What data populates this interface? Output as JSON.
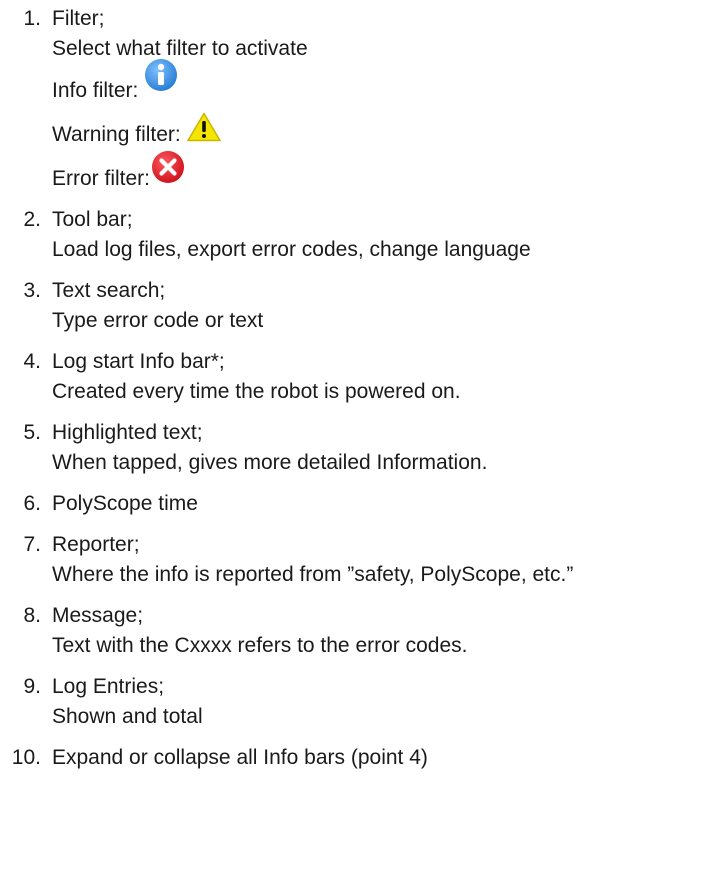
{
  "items": [
    {
      "number": "1.",
      "title": "Filter;",
      "description": "Select what filter to activate",
      "filters": [
        {
          "label": "Info filter:",
          "icon": "info-icon",
          "color": "#3b8fe0"
        },
        {
          "label": "Warning filter:",
          "icon": "warning-icon",
          "color": "#f2e600"
        },
        {
          "label": "Error filter:",
          "icon": "error-icon",
          "color": "#e0222b"
        }
      ]
    },
    {
      "number": "2.",
      "title": "Tool bar;",
      "description": "Load log files, export error codes, change language"
    },
    {
      "number": "3.",
      "title": "Text search;",
      "description": "Type error code or text"
    },
    {
      "number": "4.",
      "title": "Log start Info bar*;",
      "description": "Created every time the robot is powered on."
    },
    {
      "number": "5.",
      "title": "Highlighted text;",
      "description": "When tapped, gives more detailed Information."
    },
    {
      "number": "6.",
      "title": "PolyScope time"
    },
    {
      "number": "7.",
      "title": "Reporter;",
      "description": "Where the info is reported from ”safety, PolyScope, etc.”"
    },
    {
      "number": "8.",
      "title": "Message;",
      "description": "Text with the Cxxxx refers to the error codes."
    },
    {
      "number": "9.",
      "title": "Log Entries;",
      "description": "Shown and total"
    },
    {
      "number": "10.",
      "title": "Expand or collapse all Info bars (point 4)"
    }
  ]
}
